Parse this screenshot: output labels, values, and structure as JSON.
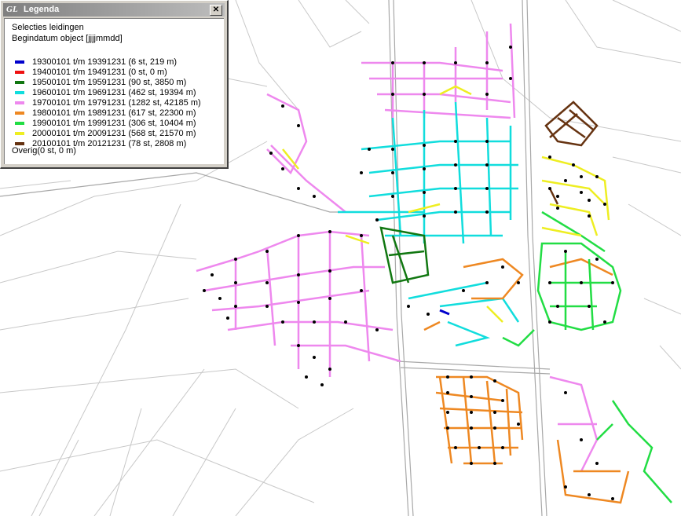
{
  "legend": {
    "logo": "GL",
    "title": "Legenda",
    "close": "✕",
    "header1": "Selecties leidingen",
    "header2": "Begindatum object [jjjjmmdd]",
    "items": [
      {
        "label": "19300101 t/m 19391231 (6 st, 219 m)",
        "color": "#0000cc"
      },
      {
        "label": "19400101 t/m 19491231 (0 st, 0 m)",
        "color": "#ee1111"
      },
      {
        "label": "19500101 t/m 19591231 (90 st, 3850 m)",
        "color": "#117711"
      },
      {
        "label": "19600101 t/m 19691231 (462 st, 19394 m)",
        "color": "#11dddd"
      },
      {
        "label": "19700101 t/m 19791231 (1282 st, 42185 m)",
        "color": "#ee88ee"
      },
      {
        "label": "19800101 t/m 19891231 (617 st, 22300 m)",
        "color": "#ee8822"
      },
      {
        "label": "19900101 t/m 19991231 (306 st, 10404 m)",
        "color": "#22dd44"
      },
      {
        "label": "20000101 t/m 20091231 (568 st, 21570 m)",
        "color": "#eeee22"
      },
      {
        "label": "20100101 t/m 20121231 (78 st, 2808 m)",
        "color": "#663311"
      }
    ],
    "other": "Overig(0 st, 0 m)"
  },
  "colors": {
    "background": "#ffffff",
    "street": "#c8c8c8",
    "node": "#000000"
  }
}
